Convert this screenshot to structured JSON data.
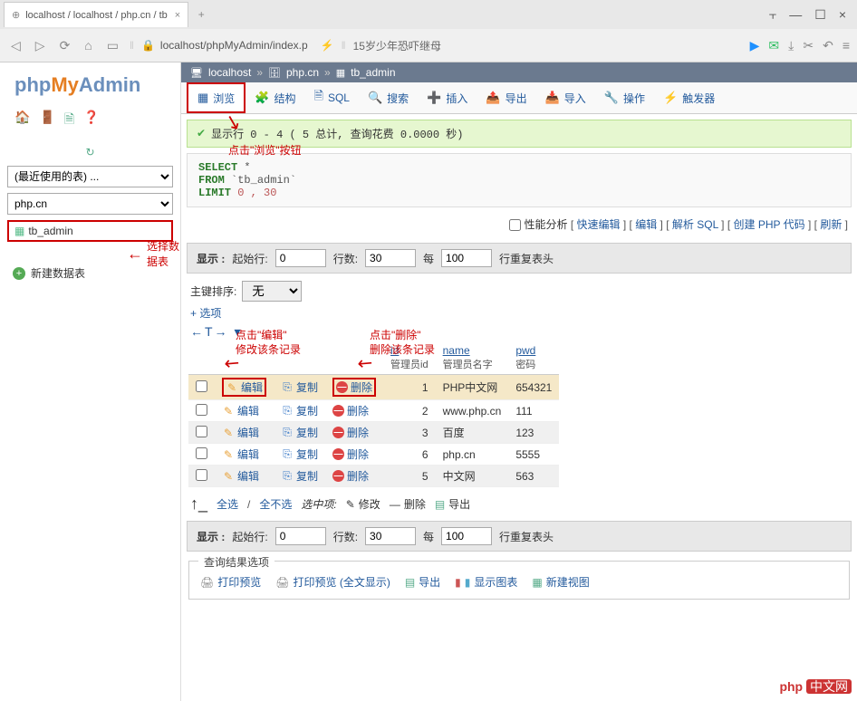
{
  "browser": {
    "tab_title": "localhost / localhost / php.cn / tb",
    "tab_close": "×",
    "newtab": "+",
    "win": {
      "pin": "⫟",
      "min": "—",
      "max": "☐",
      "close": "×"
    },
    "nav": {
      "back": "◁",
      "forward": "▷",
      "refresh": "⟳",
      "home": "⌂",
      "book": "▭"
    },
    "lock": "🔒",
    "url": "localhost/phpMyAdmin/index.p",
    "flash": "⚡",
    "sep": "‖",
    "news": "15岁少年恐吓继母",
    "right_icons": {
      "play": "▶",
      "wechat": "✉",
      "dl": "⤓",
      "cut": "✂",
      "undo": "↶",
      "menu": "≡"
    }
  },
  "sidebar": {
    "logo": {
      "a": "php",
      "b": "My",
      "c": "Admin"
    },
    "icons": {
      "home": "🏠",
      "exit": "🚪",
      "sql": "🗎",
      "help": "❓",
      "reload": "↻"
    },
    "recent_label": "(最近使用的表) ...",
    "db": "php.cn",
    "table": "tb_admin",
    "arrow_label": "选择数据表",
    "new_table": "新建数据表"
  },
  "breadcrumb": {
    "server_ico": "🖥",
    "server": "localhost",
    "db_ico": "🗄",
    "db": "php.cn",
    "tbl_ico": "▦",
    "tbl": "tb_admin",
    "sep": "»"
  },
  "tabs": [
    {
      "ico": "▦",
      "label": "浏览",
      "active": true
    },
    {
      "ico": "🧩",
      "label": "结构"
    },
    {
      "ico": "🗎",
      "label": "SQL"
    },
    {
      "ico": "🔍",
      "label": "搜索"
    },
    {
      "ico": "➕",
      "label": "插入"
    },
    {
      "ico": "📤",
      "label": "导出"
    },
    {
      "ico": "📥",
      "label": "导入"
    },
    {
      "ico": "🔧",
      "label": "操作"
    },
    {
      "ico": "⚡",
      "label": "触发器"
    }
  ],
  "annotations": {
    "browse": "点击\"浏览\"按钮",
    "edit_l1": "点击\"编辑\"",
    "edit_l2": "修改该条记录",
    "del_l1": "点击\"删除\"",
    "del_l2": "删除该条记录"
  },
  "success": {
    "chk": "✔",
    "text": "显示行 0 - 4 ( 5 总计, 查询花费 0.0000 秒)"
  },
  "sql": {
    "select": "SELECT",
    "star": "*",
    "from": "FROM",
    "tbl": "`tb_admin`",
    "limit": "LIMIT",
    "nums": "0 , 30"
  },
  "links": {
    "profiling": "性能分析",
    "items": [
      "快速编辑",
      "编辑",
      "解析 SQL",
      "创建 PHP 代码",
      "刷新"
    ]
  },
  "display": {
    "show": "显示 :",
    "start_label": "起始行:",
    "start_val": "0",
    "rows_label": "行数:",
    "rows_val": "30",
    "every": "每",
    "every_val": "100",
    "repeat": "行重复表头"
  },
  "sort": {
    "label": "主键排序:",
    "value": "无"
  },
  "options": "+ 选项",
  "hdr_controls": "←T→  ▾",
  "columns": [
    {
      "name": "id",
      "sub": "管理员id"
    },
    {
      "name": "name",
      "sub": "管理员名字"
    },
    {
      "name": "pwd",
      "sub": "密码"
    }
  ],
  "actions": {
    "edit": "编辑",
    "copy": "复制",
    "delete": "删除"
  },
  "rows": [
    {
      "id": "1",
      "name": "PHP中文网",
      "pwd": "654321",
      "sel": true
    },
    {
      "id": "2",
      "name": "www.php.cn",
      "pwd": "111"
    },
    {
      "id": "3",
      "name": "百度",
      "pwd": "123"
    },
    {
      "id": "6",
      "name": "php.cn",
      "pwd": "5555"
    },
    {
      "id": "5",
      "name": "中文网",
      "pwd": "563"
    }
  ],
  "selrow": {
    "arrow": "↳",
    "all": "全选",
    "none": "全不选",
    "with": "选中项:",
    "edit": "修改",
    "delete": "删除",
    "export": "导出"
  },
  "results": {
    "legend": "查询结果选项",
    "print1": "打印预览",
    "print2": "打印预览 (全文显示)",
    "export": "导出",
    "chart": "显示图表",
    "view": "新建视图"
  },
  "watermark": {
    "a": "php",
    "b": "中文网"
  }
}
